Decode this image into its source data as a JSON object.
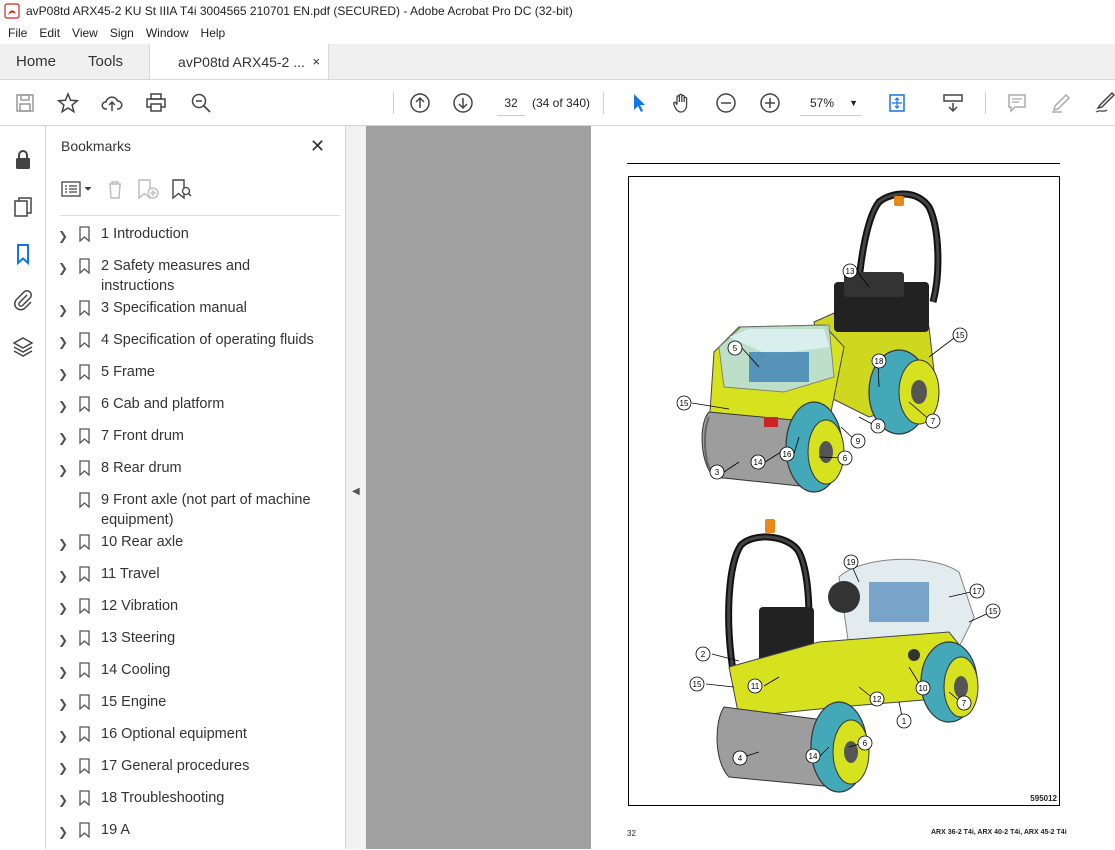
{
  "window": {
    "title": "avP08td ARX45-2 KU St IIIA T4i 3004565 210701 EN.pdf (SECURED) - Adobe Acrobat Pro DC (32-bit)"
  },
  "menu": [
    "File",
    "Edit",
    "View",
    "Sign",
    "Window",
    "Help"
  ],
  "tabs": {
    "home": "Home",
    "tools": "Tools",
    "doc": "avP08td ARX45-2 ...",
    "close": "×"
  },
  "toolbar": {
    "page_number": "32",
    "page_count": "(34 of 340)",
    "zoom": "57%"
  },
  "bookmarks": {
    "title": "Bookmarks",
    "items": [
      {
        "label": "1 Introduction",
        "expandable": true
      },
      {
        "label": "2 Safety measures and instructions",
        "expandable": true
      },
      {
        "label": "3 Specification manual",
        "expandable": true
      },
      {
        "label": "4 Specification of operating fluids",
        "expandable": true
      },
      {
        "label": "5 Frame",
        "expandable": true
      },
      {
        "label": "6 Cab and platform",
        "expandable": true
      },
      {
        "label": "7 Front drum",
        "expandable": true
      },
      {
        "label": "8 Rear drum",
        "expandable": true
      },
      {
        "label": "9 Front axle (not part of machine equipment)",
        "expandable": false
      },
      {
        "label": "10 Rear axle",
        "expandable": true
      },
      {
        "label": "11 Travel",
        "expandable": true
      },
      {
        "label": "12 Vibration",
        "expandable": true
      },
      {
        "label": "13 Steering",
        "expandable": true
      },
      {
        "label": "14 Cooling",
        "expandable": true
      },
      {
        "label": "15 Engine",
        "expandable": true
      },
      {
        "label": "16 Optional equipment",
        "expandable": true
      },
      {
        "label": "17 General procedures",
        "expandable": true
      },
      {
        "label": "18 Troubleshooting",
        "expandable": true
      },
      {
        "label": "19 A",
        "expandable": true
      }
    ]
  },
  "document": {
    "figure_id": "595012",
    "page_number": "32",
    "footer_title": "ARX 36-2 T4i, ARX 40-2 T4i, ARX 45-2 T4i",
    "callouts_top": [
      "13",
      "15",
      "5",
      "18",
      "15",
      "7",
      "8",
      "9",
      "14",
      "16",
      "6",
      "3"
    ],
    "callouts_bottom": [
      "19",
      "17",
      "15",
      "2",
      "15",
      "11",
      "10",
      "12",
      "1",
      "7",
      "6",
      "14",
      "4"
    ]
  },
  "colors": {
    "machine_yellow": "#d7e21f",
    "drum_teal": "#43a9b8",
    "acrobat_red": "#d9261c"
  }
}
